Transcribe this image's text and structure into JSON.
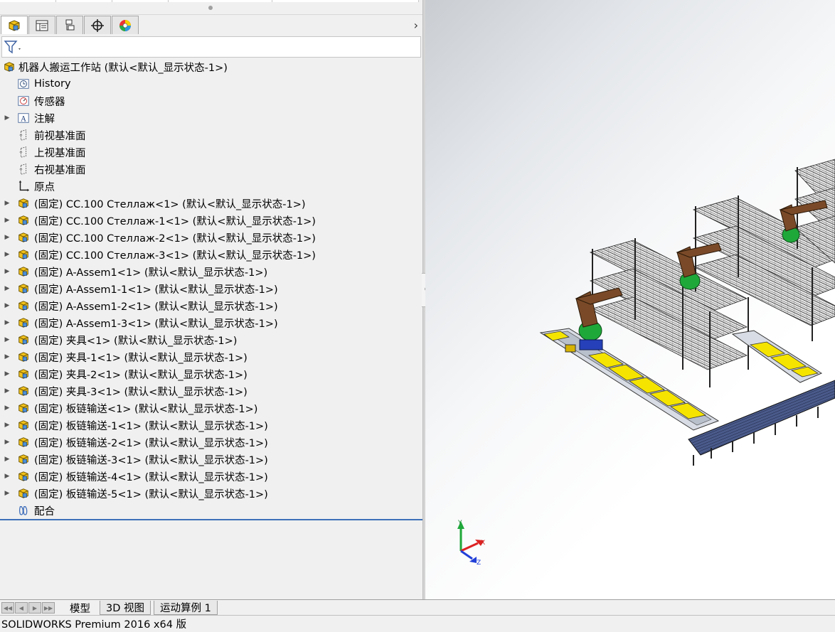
{
  "tree": {
    "root": "机器人搬运工作站  (默认<默认_显示状态-1>)",
    "items": [
      {
        "label": "History",
        "icon": "history-icon",
        "expandable": false
      },
      {
        "label": "传感器",
        "icon": "sensor-icon",
        "expandable": false
      },
      {
        "label": "注解",
        "icon": "annotation-icon",
        "expandable": true
      },
      {
        "label": "前视基准面",
        "icon": "plane-icon",
        "expandable": false
      },
      {
        "label": "上视基准面",
        "icon": "plane-icon",
        "expandable": false
      },
      {
        "label": "右视基准面",
        "icon": "plane-icon",
        "expandable": false
      },
      {
        "label": "原点",
        "icon": "origin-icon",
        "expandable": false
      },
      {
        "label": "(固定) CC.100 Стеллаж<1> (默认<默认_显示状态-1>)",
        "icon": "assembly-icon",
        "expandable": true
      },
      {
        "label": "(固定) CC.100 Стеллаж-1<1> (默认<默认_显示状态-1>)",
        "icon": "assembly-icon",
        "expandable": true
      },
      {
        "label": "(固定) CC.100 Стеллаж-2<1> (默认<默认_显示状态-1>)",
        "icon": "assembly-icon",
        "expandable": true
      },
      {
        "label": "(固定) CC.100 Стеллаж-3<1> (默认<默认_显示状态-1>)",
        "icon": "assembly-icon",
        "expandable": true
      },
      {
        "label": "(固定) A-Assem1<1> (默认<默认_显示状态-1>)",
        "icon": "assembly-icon",
        "expandable": true
      },
      {
        "label": "(固定) A-Assem1-1<1> (默认<默认_显示状态-1>)",
        "icon": "assembly-icon",
        "expandable": true
      },
      {
        "label": "(固定) A-Assem1-2<1> (默认<默认_显示状态-1>)",
        "icon": "assembly-icon",
        "expandable": true
      },
      {
        "label": "(固定) A-Assem1-3<1> (默认<默认_显示状态-1>)",
        "icon": "assembly-icon",
        "expandable": true
      },
      {
        "label": "(固定) 夹具<1> (默认<默认_显示状态-1>)",
        "icon": "assembly-icon",
        "expandable": true
      },
      {
        "label": "(固定) 夹具-1<1> (默认<默认_显示状态-1>)",
        "icon": "assembly-icon",
        "expandable": true
      },
      {
        "label": "(固定) 夹具-2<1> (默认<默认_显示状态-1>)",
        "icon": "assembly-icon",
        "expandable": true
      },
      {
        "label": "(固定) 夹具-3<1> (默认<默认_显示状态-1>)",
        "icon": "assembly-icon",
        "expandable": true
      },
      {
        "label": "(固定) 板链输送<1> (默认<默认_显示状态-1>)",
        "icon": "assembly-icon",
        "expandable": true
      },
      {
        "label": "(固定) 板链输送-1<1> (默认<默认_显示状态-1>)",
        "icon": "assembly-icon",
        "expandable": true
      },
      {
        "label": "(固定) 板链输送-2<1> (默认<默认_显示状态-1>)",
        "icon": "assembly-icon",
        "expandable": true
      },
      {
        "label": "(固定) 板链输送-3<1> (默认<默认_显示状态-1>)",
        "icon": "assembly-icon",
        "expandable": true
      },
      {
        "label": "(固定) 板链输送-4<1> (默认<默认_显示状态-1>)",
        "icon": "assembly-icon",
        "expandable": true
      },
      {
        "label": "(固定) 板链输送-5<1> (默认<默认_显示状态-1>)",
        "icon": "assembly-icon",
        "expandable": true
      },
      {
        "label": "配合",
        "icon": "mates-icon",
        "expandable": false
      }
    ]
  },
  "panel_tabs": [
    {
      "name": "feature-manager-tab",
      "icon": "assembly-icon",
      "active": true
    },
    {
      "name": "property-manager-tab",
      "icon": "property-manager-icon",
      "active": false
    },
    {
      "name": "configuration-manager-tab",
      "icon": "configuration-manager-icon",
      "active": false
    },
    {
      "name": "dimxpert-manager-tab",
      "icon": "crosshair-icon",
      "active": false
    },
    {
      "name": "display-manager-tab",
      "icon": "color-wheel-icon",
      "active": false
    }
  ],
  "triad": {
    "x": "X",
    "y": "Y",
    "z": "Z"
  },
  "bottom_tabs": [
    "模型",
    "3D 视图",
    "运动算例 1"
  ],
  "status": "SOLIDWORKS Premium 2016 x64 版",
  "colors": {
    "tree_accent": "#3e70b8",
    "yellow_part": "#f5e400",
    "robot_green": "#1fa83a",
    "robot_brown": "#7a4a28"
  }
}
